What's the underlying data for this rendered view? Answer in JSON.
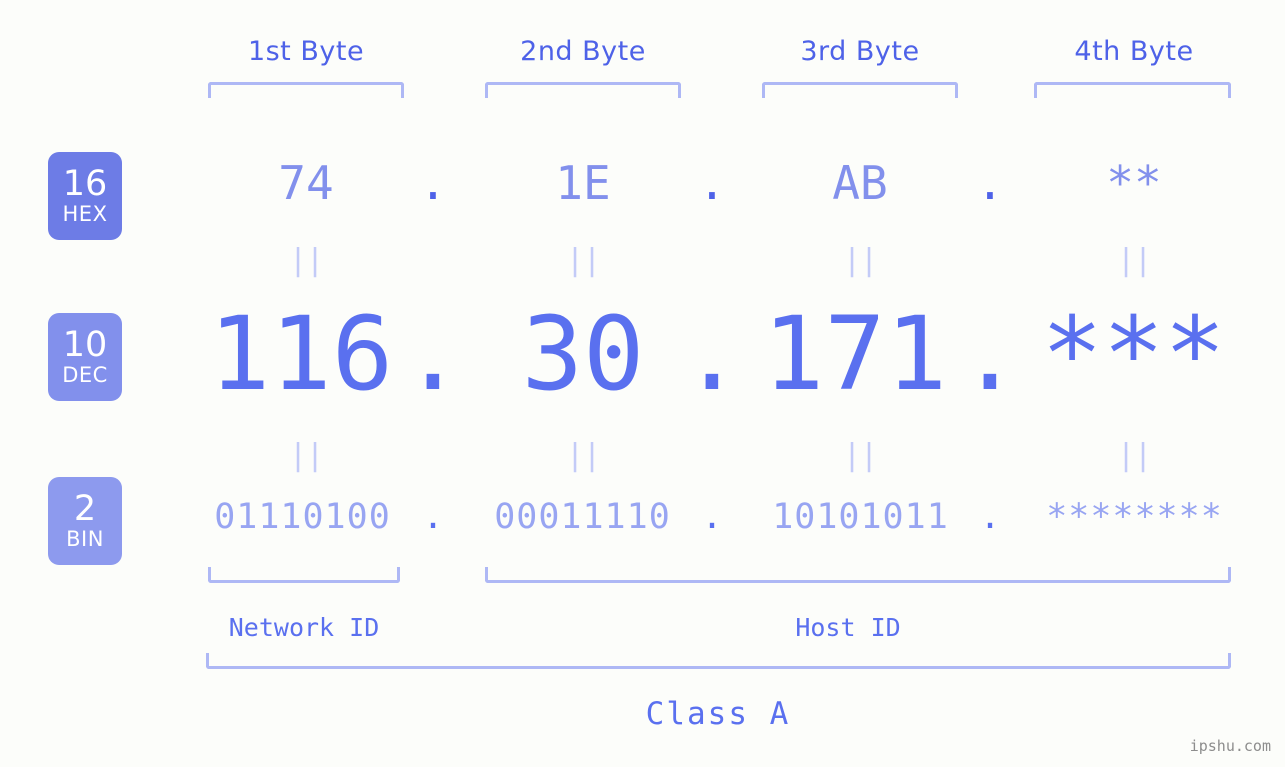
{
  "background_color": "#fcfdfa",
  "accent_color": "#5a70ef",
  "badge_color": "#7b87e8",
  "bracket_color": "#aeb8f5",
  "byte_headers": [
    {
      "label": "1st Byte"
    },
    {
      "label": "2nd Byte"
    },
    {
      "label": "3rd Byte"
    },
    {
      "label": "4th Byte"
    }
  ],
  "rows": [
    {
      "base_number": "16",
      "base_name": "HEX",
      "values": [
        "74",
        "1E",
        "AB",
        "**"
      ],
      "separator": "."
    },
    {
      "base_number": "10",
      "base_name": "DEC",
      "values": [
        "116",
        "30",
        "171",
        "***"
      ],
      "separator": "."
    },
    {
      "base_number": "2",
      "base_name": "BIN",
      "values": [
        "01110100",
        "00011110",
        "10101011",
        "********"
      ],
      "separator": "."
    }
  ],
  "equality_mark": "||",
  "segments": {
    "network_id": "Network ID",
    "host_id": "Host ID"
  },
  "class_label": "Class A",
  "watermark": "ipshu.com"
}
